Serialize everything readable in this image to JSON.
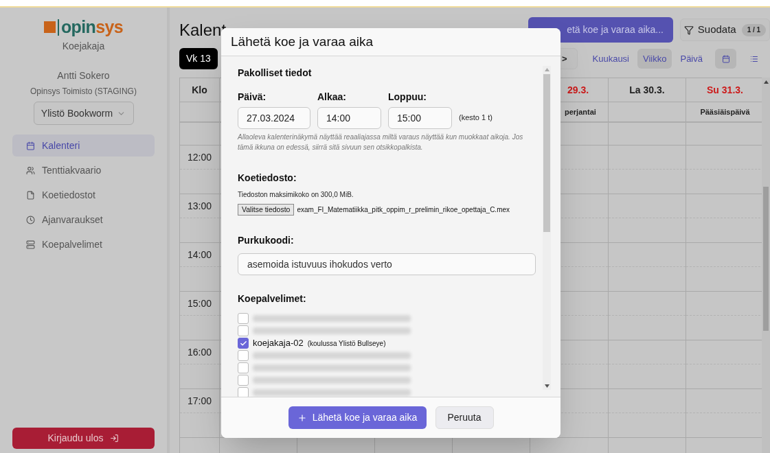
{
  "sidebar": {
    "logo": {
      "part1": "opin",
      "part2": "sys"
    },
    "app_name": "Koejakaja",
    "user": {
      "name": "Antti Sokero",
      "organisation": "Opinsys Toimisto (STAGING)"
    },
    "school_select": {
      "value": "Ylistö Bookworm"
    },
    "items": [
      {
        "label": "Kalenteri",
        "selected": true
      },
      {
        "label": "Tenttiakvaario",
        "selected": false
      },
      {
        "label": "Koetiedostot",
        "selected": false
      },
      {
        "label": "Ajanvaraukset",
        "selected": false
      },
      {
        "label": "Koepalvelimet",
        "selected": false
      }
    ],
    "logout_button": "Kirjaudu ulos"
  },
  "page": {
    "title": "Kalent",
    "send_button": "etä koe ja varaa aika...",
    "filter_button": {
      "label": "Suodata",
      "badge": "1 / 1"
    },
    "week_badge": "Vk 13",
    "next_button": ">",
    "views": [
      {
        "label": "Kuukausi",
        "selected": false
      },
      {
        "label": "Viikko",
        "selected": true
      },
      {
        "label": "Päivä",
        "selected": false
      }
    ],
    "display_modes": [
      {
        "selected": true
      },
      {
        "selected": false
      }
    ]
  },
  "calendar": {
    "time_header": "Klo",
    "days": [
      {
        "label": "29.3.",
        "holiday": true,
        "note": "perjantai"
      },
      {
        "label": "La 30.3.",
        "holiday": false
      },
      {
        "label": "Su 31.3.",
        "holiday": true,
        "note": "Pääsiäispäivä"
      }
    ],
    "hours": [
      "12:00",
      "13:00",
      "14:00",
      "15:00",
      "16:00",
      "17:00"
    ]
  },
  "dialog": {
    "title": "Lähetä koe ja varaa aika",
    "section_title": "Pakolliset tiedot",
    "date": {
      "label": "Päivä:",
      "value": "27.03.2024"
    },
    "start": {
      "label": "Alkaa:",
      "value": "14:00"
    },
    "end": {
      "label": "Loppuu:",
      "value": "15:00"
    },
    "duration": "(kesto 1 t)",
    "hint": "Allaoleva kalenterinäkymä näyttää reaaliajassa miltä varaus näyttää kun muokkaat aikoja. Jos tämä ikkuna on edessä, siirrä sitä sivuun sen otsikkopalkista.",
    "file_label": "Koetiedosto:",
    "file_note": "Tiedoston maksimikoko on 300,0 MiB.",
    "file_button": "Valitse tiedosto",
    "file_name": "exam_FI_Matematiikka_pitk_oppim_r_prelimin_rikoe_opettaja_C.mex",
    "code_label": "Purkukoodi:",
    "code_value": "asemoida istuvuus ihokudos verto",
    "servers_label": "Koepalvelimet:",
    "servers": [
      {
        "kind": "blurred",
        "checked": false
      },
      {
        "kind": "blurred",
        "checked": false
      },
      {
        "kind": "server",
        "name": "koejakaja-02",
        "school": "(koulussa Ylistö Bullseye)",
        "checked": true
      },
      {
        "kind": "blurred",
        "checked": false
      },
      {
        "kind": "blurred",
        "checked": false
      },
      {
        "kind": "blurred",
        "checked": false
      },
      {
        "kind": "blurred",
        "checked": false
      }
    ],
    "submit_button": "Lähetä koe ja varaa aika",
    "cancel_button": "Peruuta"
  }
}
